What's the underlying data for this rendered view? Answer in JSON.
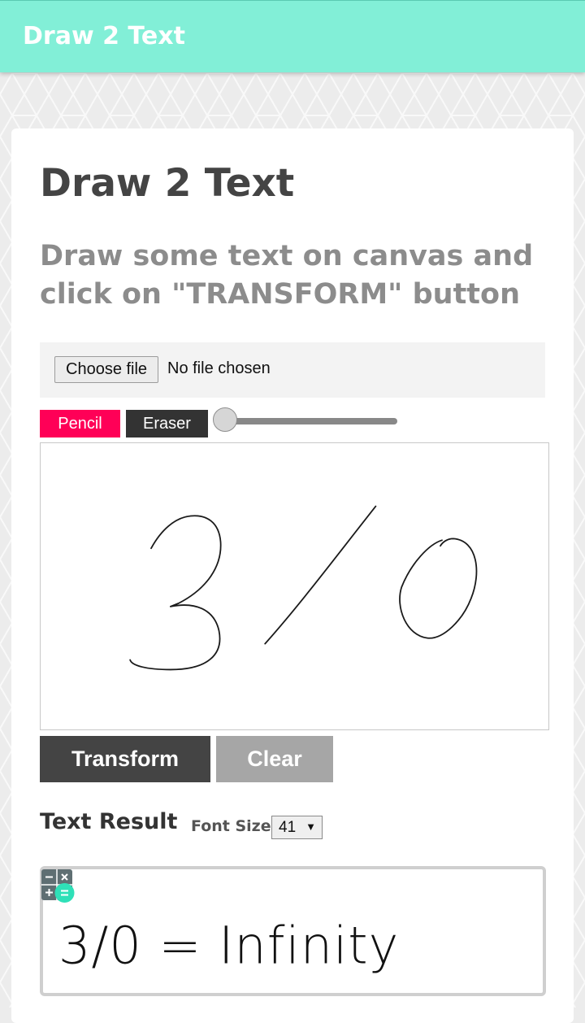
{
  "app_bar": {
    "title": "Draw 2 Text"
  },
  "main": {
    "title": "Draw 2 Text",
    "subtitle": "Draw some text on canvas and click on \"TRANSFORM\" button"
  },
  "file_input": {
    "button_label": "Choose file",
    "status": "No file chosen"
  },
  "tools": {
    "pencil_label": "Pencil",
    "eraser_label": "Eraser",
    "brush_size_fraction": 0
  },
  "actions": {
    "transform_label": "Transform",
    "clear_label": "Clear"
  },
  "result": {
    "label": "Text Result",
    "font_size_label": "Font Size",
    "font_size_value": "41",
    "text": "3/0 = Infinity"
  },
  "colors": {
    "app_bar": "#82efd7",
    "pencil": "#ff0057",
    "eraser": "#333333",
    "transform": "#444444",
    "clear": "#a6a6a6"
  },
  "icons": {
    "calculator": "calculator-icon",
    "select_arrow": "chevron-down-icon"
  }
}
